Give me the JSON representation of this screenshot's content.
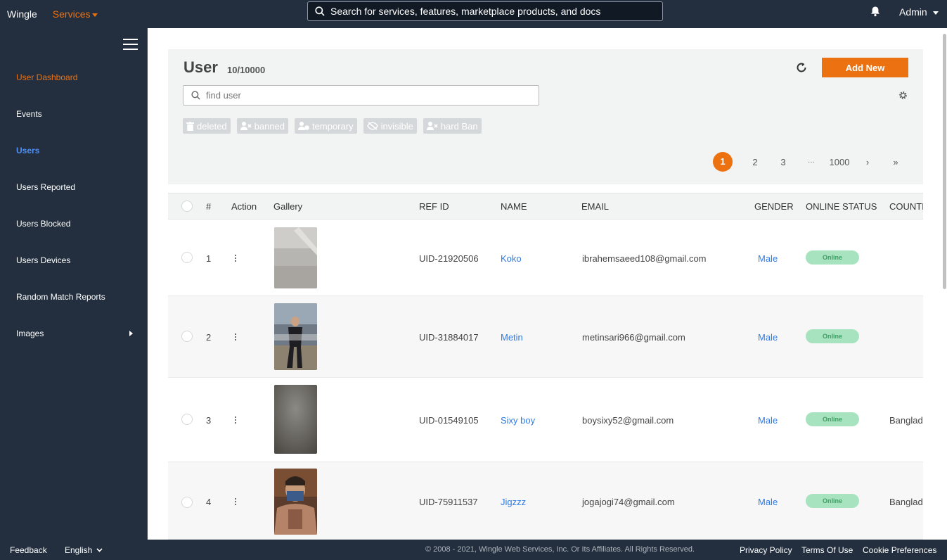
{
  "topbar": {
    "brand": "Wingle",
    "services_label": "Services",
    "search_placeholder": "Search for services, features, marketplace products, and docs",
    "admin_label": "Admin"
  },
  "sidebar": {
    "items": [
      {
        "label": "User Dashboard"
      },
      {
        "label": "Events"
      },
      {
        "label": "Users"
      },
      {
        "label": "Users Reported"
      },
      {
        "label": "Users Blocked"
      },
      {
        "label": "Users Devices"
      },
      {
        "label": "Random Match Reports"
      },
      {
        "label": "Images"
      }
    ]
  },
  "main": {
    "title": "User",
    "count": "10/10000",
    "add_new_label": "Add New",
    "find_placeholder": "find user",
    "filters": [
      {
        "label": "deleted",
        "icon": "trash-icon"
      },
      {
        "label": "banned",
        "icon": "user-ban-icon"
      },
      {
        "label": "temporary",
        "icon": "user-clock-icon"
      },
      {
        "label": "invisible",
        "icon": "eye-slash-icon"
      },
      {
        "label": "hard Ban",
        "icon": "user-ban-icon"
      }
    ],
    "pagination": {
      "pages": [
        "1",
        "2",
        "3",
        "···",
        "1000",
        "›",
        "»"
      ],
      "current": "1"
    }
  },
  "table": {
    "headers": [
      "#",
      "Action",
      "Gallery",
      "REF ID",
      "NAME",
      "EMAIL",
      "GENDER",
      "ONLINE STATUS",
      "COUNTRY"
    ],
    "rows": [
      {
        "num": "1",
        "ref": "UID-21920506",
        "name": "Koko",
        "email": "ibrahemsaeed108@gmail.com",
        "gender": "Male",
        "status": "Online",
        "country": ""
      },
      {
        "num": "2",
        "ref": "UID-31884017",
        "name": "Metin",
        "email": "metinsari966@gmail.com",
        "gender": "Male",
        "status": "Online",
        "country": ""
      },
      {
        "num": "3",
        "ref": "UID-01549105",
        "name": "Sixy boy",
        "email": "boysixy52@gmail.com",
        "gender": "Male",
        "status": "Online",
        "country": "Bangladesh"
      },
      {
        "num": "4",
        "ref": "UID-75911537",
        "name": "Jigzzz",
        "email": "jogajogi74@gmail.com",
        "gender": "Male",
        "status": "Online",
        "country": "Bangladesh"
      }
    ]
  },
  "footer": {
    "feedback": "Feedback",
    "language": "English",
    "copyright": "© 2008 - 2021, Wingle Web Services, Inc. Or Its Affiliates. All Rights Reserved.",
    "privacy": "Privacy Policy",
    "terms": "Terms Of Use",
    "cookies": "Cookie Preferences"
  },
  "colors": {
    "accent": "#ec7211",
    "link": "#2f7be6",
    "nav_bg": "#232f3e",
    "online_bg": "#a8e3c0",
    "online_text": "#3e9e63"
  }
}
